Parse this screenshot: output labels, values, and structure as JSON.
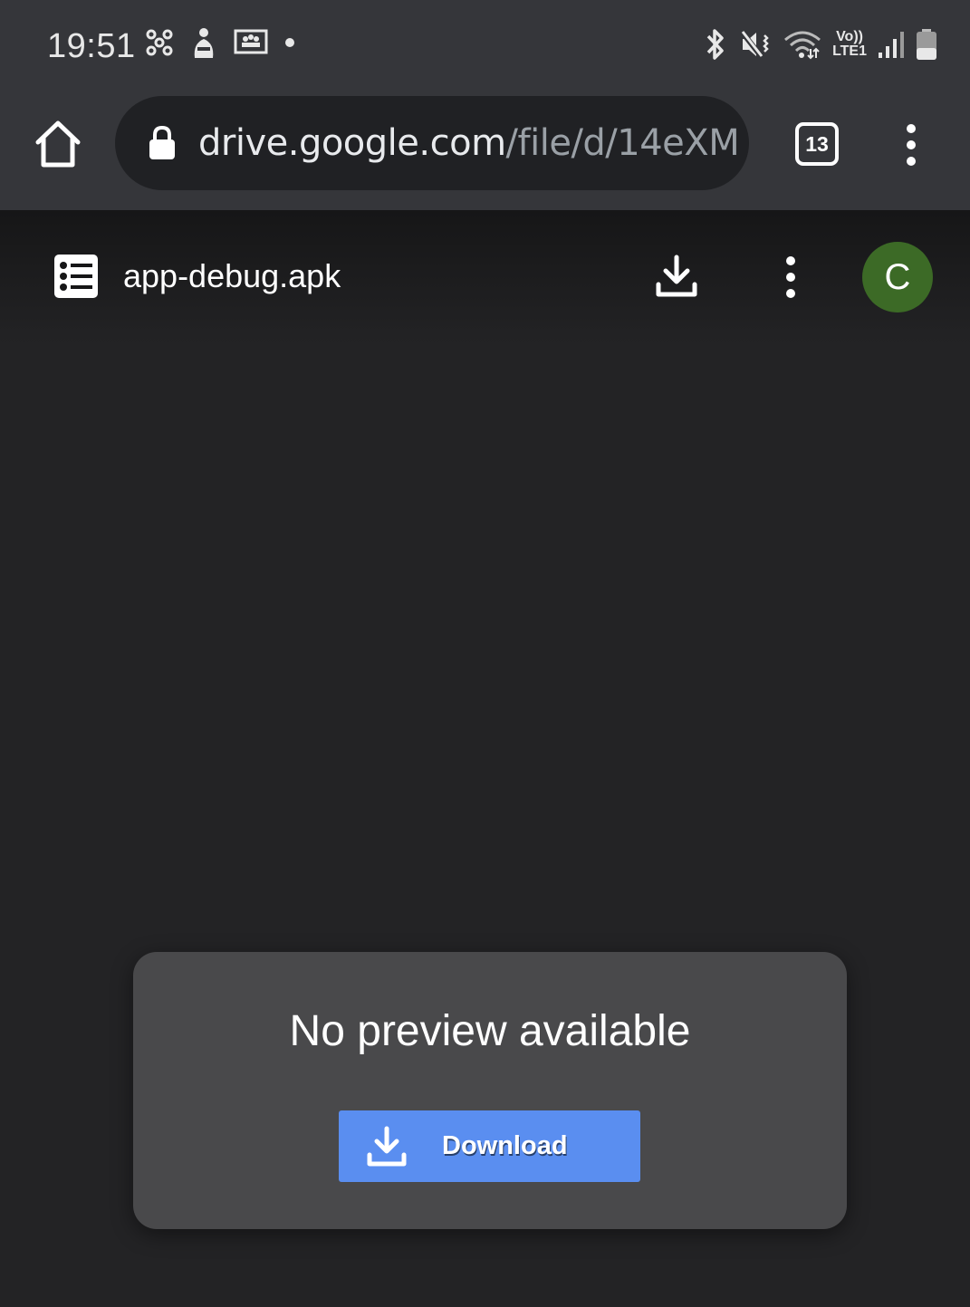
{
  "status_bar": {
    "time": "19:51",
    "left_icons": [
      "cluster-icon",
      "game-launcher-icon",
      "screen-share-icon",
      "notification-dot-icon"
    ],
    "right_icons": [
      "bluetooth-icon",
      "mute-vibrate-icon",
      "wifi-icon",
      "volte-lte-icon",
      "signal-icon",
      "battery-icon"
    ],
    "volte_label": "Vo))",
    "lte_label": "LTE1"
  },
  "browser": {
    "url_domain": "drive.google.com",
    "url_path": "/file/d/14eXM",
    "tab_count": "13"
  },
  "drive_header": {
    "file_name": "app-debug.apk",
    "avatar_letter": "C",
    "avatar_color": "#3c6a26"
  },
  "preview": {
    "message": "No preview available",
    "download_label": "Download",
    "button_color": "#5a8ef0"
  }
}
